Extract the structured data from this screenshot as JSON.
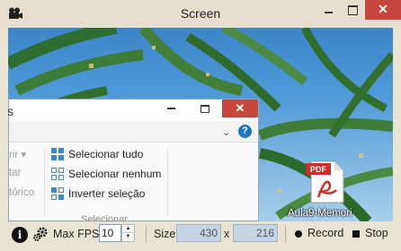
{
  "window": {
    "title": "Screen",
    "close_glyph": "✕",
    "icons": {
      "app": "camera-icon",
      "minimize": "minimize-icon",
      "maximize": "maximize-icon",
      "close": "close-icon"
    },
    "close_color": "#c7463d"
  },
  "explorer": {
    "title_fragment": "s",
    "close_glyph": "✕",
    "help_glyph": "?",
    "chevron_glyph": "⌄",
    "left_fragments": [
      "rir ▾",
      "tar",
      "tórico"
    ],
    "select_items": [
      "Selecionar tudo",
      "Selecionar nenhum",
      "Inverter seleção"
    ],
    "group_label": "Selecionar"
  },
  "desktop_file": {
    "badge": "PDF",
    "name": "Aula9-Memori"
  },
  "toolbar": {
    "info_glyph": "i",
    "max_fps_label": "Max FPS",
    "max_fps_value": "10",
    "size_label": "Size",
    "width_value": "430",
    "times_label": "x",
    "height_value": "216",
    "record_label": "Record",
    "stop_label": "Stop"
  }
}
